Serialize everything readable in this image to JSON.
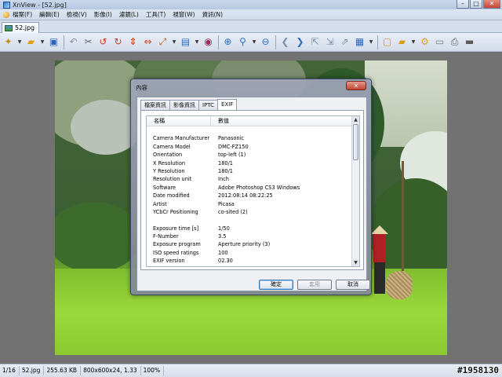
{
  "window": {
    "title": "XnView - [52.jpg]"
  },
  "menubar": {
    "items": [
      "檔案(F)",
      "編輯(E)",
      "檢視(V)",
      "影像(I)",
      "濾鏡(L)",
      "工具(T)",
      "視窗(W)",
      "資訊(N)"
    ]
  },
  "document_tab": {
    "label": "52.jpg"
  },
  "dialog": {
    "title": "內容",
    "close_label": "✕",
    "tabs": [
      "檔案資訊",
      "影像資訊",
      "IPTC",
      "EXIF"
    ],
    "active_tab": "EXIF",
    "columns": {
      "name": "名稱",
      "value": "數值"
    },
    "rows": [
      {
        "k": "",
        "v": ""
      },
      {
        "k": "Camera Manufacturer",
        "v": "Panasonic"
      },
      {
        "k": "Camera Model",
        "v": "DMC-FZ150"
      },
      {
        "k": "Orientation",
        "v": "top-left (1)"
      },
      {
        "k": "X Resolution",
        "v": "180/1"
      },
      {
        "k": "Y Resolution",
        "v": "180/1"
      },
      {
        "k": "Resolution unit",
        "v": "Inch"
      },
      {
        "k": "Software",
        "v": "Adobe Photoshop CS3 Windows"
      },
      {
        "k": "Date modified",
        "v": "2012:08:14 08:22:25"
      },
      {
        "k": "Artist",
        "v": "Picasa"
      },
      {
        "k": "YCbCr Positioning",
        "v": "co-sited (2)"
      },
      {
        "k": "",
        "v": ""
      },
      {
        "k": "Exposure time [s]",
        "v": "1/50"
      },
      {
        "k": "F-Number",
        "v": "3.5"
      },
      {
        "k": "Exposure program",
        "v": "Aperture priority (3)"
      },
      {
        "k": "ISO speed ratings",
        "v": "100"
      },
      {
        "k": "EXIF version",
        "v": "02.30"
      }
    ],
    "buttons": {
      "ok": "確定",
      "apply": "套用",
      "cancel": "取消"
    }
  },
  "statusbar": {
    "index": "1/16",
    "filename": "52.jpg",
    "filesize": "255.63 KB",
    "dimensions": "800x600x24, 1.33",
    "zoom": "100%"
  },
  "watermark": "#1958130"
}
